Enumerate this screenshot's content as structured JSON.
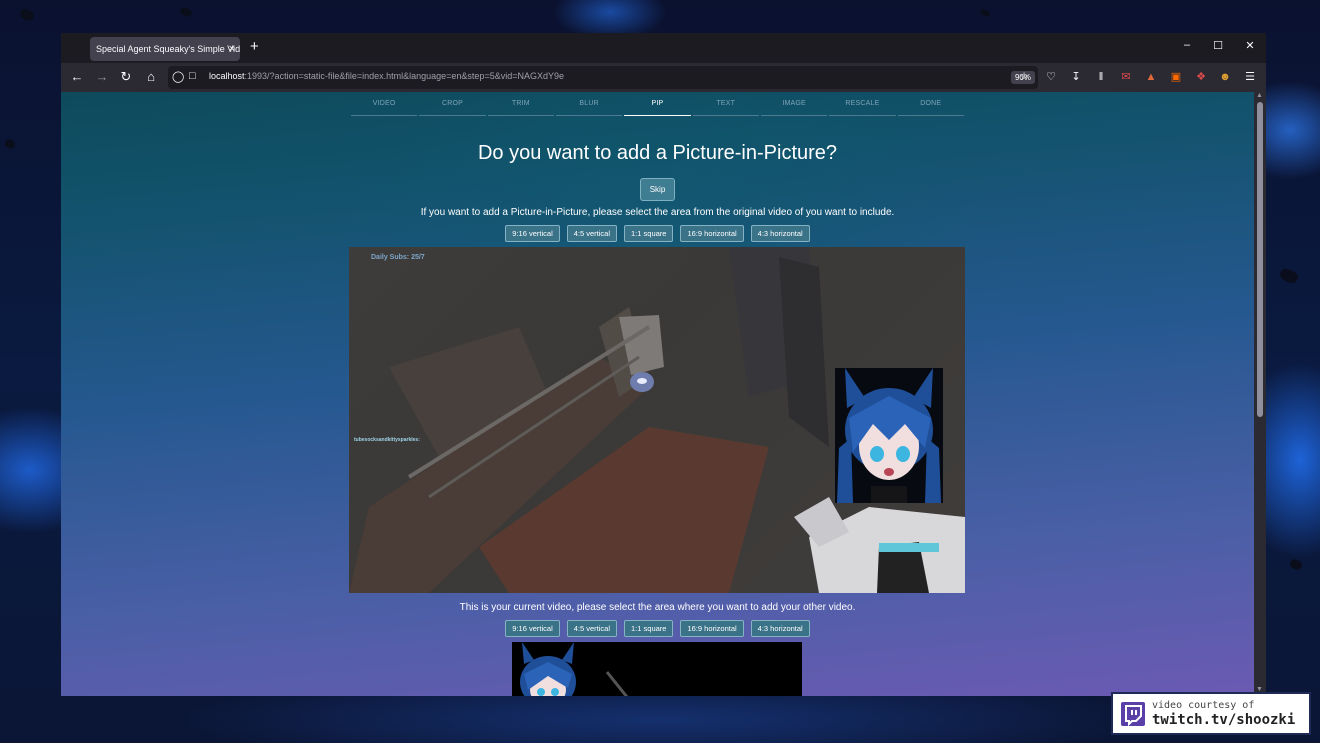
{
  "browser": {
    "tab_title": "Special Agent Squeaky's Simple Vide",
    "tab_close": "×",
    "new_tab": "+",
    "url_host": "localhost",
    "url_rest": ":1993/?action=static-file&file=index.html&language=en&step=5&vid=NAGXdY9e",
    "zoom": "90%",
    "window_controls": [
      "minimize",
      "maximize",
      "close"
    ],
    "toolbar_icons": [
      "star-icon",
      "pocket-icon",
      "download-icon",
      "library-icon",
      "extension-mail-icon",
      "extension-shape-icon",
      "extension-square-icon",
      "extension-off-icon",
      "extension-face-icon",
      "menu-icon"
    ],
    "extension_badges": {
      "mail": "1",
      "off": "off"
    }
  },
  "steps": [
    "VIDEO",
    "CROP",
    "TRIM",
    "BLUR",
    "PIP",
    "TEXT",
    "IMAGE",
    "RESCALE",
    "DONE"
  ],
  "active_step": "PIP",
  "page": {
    "heading": "Do you want to add a Picture-in-Picture?",
    "skip_label": "Skip",
    "instruction_source": "If you want to add a Picture-in-Picture, please select the area from the original video of you want to include.",
    "instruction_target": "This is your current video, please select the area where you want to add your other video.",
    "ratio_options": [
      "9:16 vertical",
      "4:5 vertical",
      "1:1 square",
      "16:9 horizontal",
      "4:3 horizontal"
    ]
  },
  "video_overlay": {
    "daily_subs": "Daily Subs: 25/7",
    "chat_user": "tubesocksandkittysparkles:"
  },
  "watermark": {
    "line1": "video courtesy of",
    "line2": "twitch.tv/shoozki"
  },
  "colors": {
    "accent": "#3f7d92",
    "page_gradient_top": "#0e4a5c",
    "page_gradient_bottom": "#6b5ab3",
    "browser_chrome": "#1c1b22"
  }
}
